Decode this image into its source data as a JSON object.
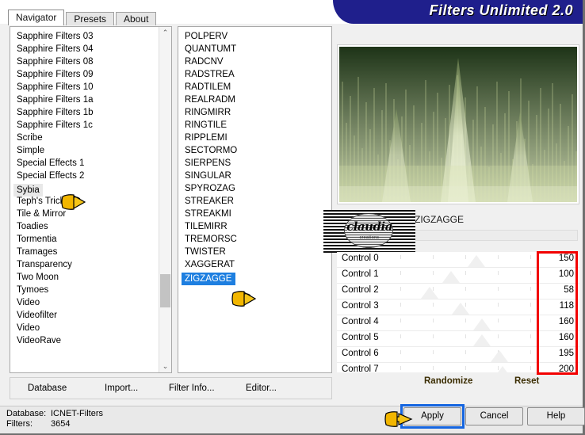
{
  "window": {
    "title": "Filters Unlimited 2.0",
    "accent_blue": "#1f1f8c"
  },
  "tabs": [
    {
      "label": "Navigator",
      "active": true
    },
    {
      "label": "Presets",
      "active": false
    },
    {
      "label": "About",
      "active": false
    }
  ],
  "category_list": {
    "selected": "Sybia",
    "items": [
      "Sapphire Filters 03",
      "Sapphire Filters 04",
      "Sapphire Filters 08",
      "Sapphire Filters 09",
      "Sapphire Filters 10",
      "Sapphire Filters 1a",
      "Sapphire Filters 1b",
      "Sapphire Filters 1c",
      "Scribe",
      "Simple",
      "Special Effects 1",
      "Special Effects 2",
      "Sybia",
      "Teph's Tricks",
      "Tile & Mirror",
      "Toadies",
      "Tormentia",
      "Tramages",
      "Transparency",
      "Two Moon",
      "Tymoes",
      "Video",
      "Videofilter",
      "Video",
      "VideoRave"
    ]
  },
  "filter_list": {
    "selected": "ZIGZAGGE",
    "items": [
      "POLPERV",
      "QUANTUMT",
      "RADCNV",
      "RADSTREA",
      "RADTILEM",
      "REALRADM",
      "RINGMIRR",
      "RINGTILE",
      "RIPPLEMI",
      "SECTORMO",
      "SIERPENS",
      "SINGULAR",
      "SPYROZAG",
      "STREAKER",
      "STREAKMI",
      "TILEMIRR",
      "TREMORSC",
      "TWISTER",
      "XAGGERAT",
      "ZIGZAGGE"
    ]
  },
  "preset": {
    "name": "ZIGZAGGE",
    "field_value": "",
    "watermark_text": "claudia",
    "watermark_sub": "creations"
  },
  "controls": {
    "rows": [
      {
        "label": "Control 0",
        "value": "150"
      },
      {
        "label": "Control 1",
        "value": "100"
      },
      {
        "label": "Control 2",
        "value": "58"
      },
      {
        "label": "Control 3",
        "value": "118"
      },
      {
        "label": "Control 4",
        "value": "160"
      },
      {
        "label": "Control 5",
        "value": "160"
      },
      {
        "label": "Control 6",
        "value": "195"
      },
      {
        "label": "Control 7",
        "value": "200"
      }
    ],
    "randomize_label": "Randomize",
    "reset_label": "Reset"
  },
  "menu": {
    "database": "Database",
    "import": "Import...",
    "filter_info": "Filter Info...",
    "editor": "Editor..."
  },
  "status": {
    "database_label": "Database:",
    "database_value": "ICNET-Filters",
    "filters_label": "Filters:",
    "filters_value": "3654"
  },
  "dialog_buttons": {
    "apply": "Apply",
    "cancel": "Cancel",
    "help": "Help"
  },
  "annotations": {
    "red_box_color": "#f20000",
    "blue_box_color": "#1565e0"
  },
  "scrollbars": {
    "up_arrow": "⌃",
    "down_arrow": "⌄"
  }
}
